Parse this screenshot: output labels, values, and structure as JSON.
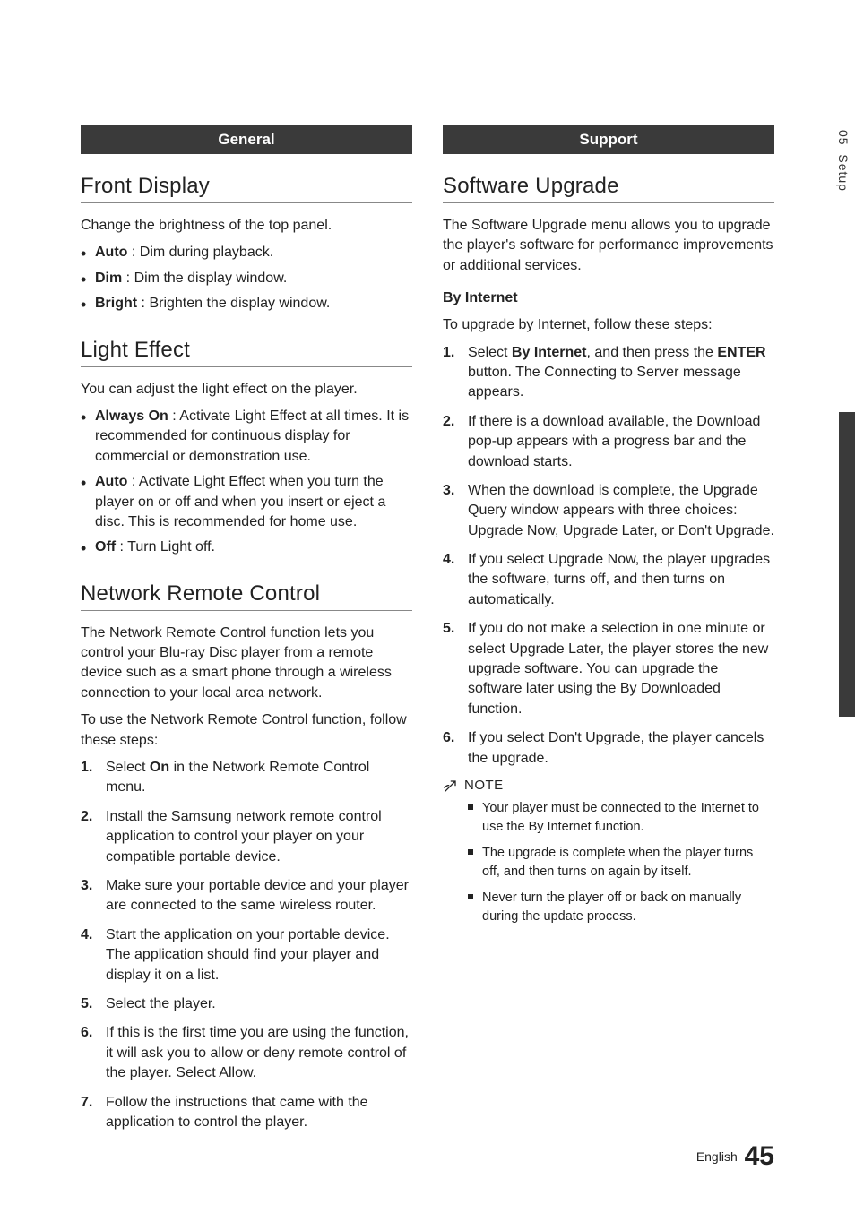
{
  "side": {
    "chapter": "05",
    "label": "Setup"
  },
  "left": {
    "banner": "General",
    "frontDisplay": {
      "title": "Front Display",
      "intro": "Change the brightness of the top panel.",
      "items": [
        {
          "label": "Auto",
          "desc": " : Dim during playback."
        },
        {
          "label": "Dim",
          "desc": " : Dim the display window."
        },
        {
          "label": "Bright",
          "desc": " : Brighten the display window."
        }
      ]
    },
    "lightEffect": {
      "title": "Light Effect",
      "intro": "You can adjust the light effect on the player.",
      "items": [
        {
          "label": "Always On",
          "desc": " : Activate Light Effect at all times. It is recommended for continuous display for commercial or demonstration use."
        },
        {
          "label": "Auto",
          "desc": " : Activate Light Effect when you turn the player on or off and when you insert or eject a disc. This is recommended for home use."
        },
        {
          "label": "Off",
          "desc": " : Turn Light off."
        }
      ]
    },
    "networkRemote": {
      "title": "Network Remote Control",
      "intro1": "The Network Remote Control function lets you control your Blu-ray Disc player from a remote device such as a smart phone through a wireless connection to your local area network.",
      "intro2": "To use the Network Remote Control function, follow these steps:",
      "steps": [
        {
          "n": "1.",
          "pre": "Select ",
          "bold": "On",
          "post": " in the Network Remote Control menu."
        },
        {
          "n": "2.",
          "text": "Install the Samsung network remote control application to control your player on your compatible portable device."
        },
        {
          "n": "3.",
          "text": "Make sure your portable device and your player are connected to the same wireless router."
        },
        {
          "n": "4.",
          "text": "Start the application on your portable device. The application should find your player and display it on a list."
        },
        {
          "n": "5.",
          "text": "Select the player."
        },
        {
          "n": "6.",
          "text": "If this is the first time you are using the function, it will ask you to allow or deny remote control of the player. Select Allow."
        },
        {
          "n": "7.",
          "text": "Follow the instructions that came with the application to control the player."
        }
      ]
    }
  },
  "right": {
    "banner": "Support",
    "softwareUpgrade": {
      "title": "Software Upgrade",
      "intro": "The Software Upgrade menu allows you to upgrade the player's software for performance improvements or additional services.",
      "byInternetTitle": "By Internet",
      "byInternetIntro": "To upgrade by Internet, follow these steps:",
      "steps": [
        {
          "n": "1.",
          "pre": "Select ",
          "bold1": "By Internet",
          "mid": ", and then press the ",
          "bold2": "ENTER",
          "post": " button. The Connecting to Server message appears."
        },
        {
          "n": "2.",
          "text": "If there is a download available, the Download pop-up appears with a progress bar and the download starts."
        },
        {
          "n": "3.",
          "text": "When the download is complete, the Upgrade Query window appears with three choices: Upgrade Now, Upgrade Later, or Don't Upgrade."
        },
        {
          "n": "4.",
          "text": "If you select Upgrade Now, the player upgrades the software, turns off, and then turns on automatically."
        },
        {
          "n": "5.",
          "text": "If you do not make a selection in one minute or select Upgrade Later, the player stores the new upgrade software. You can upgrade the software later using the By Downloaded function."
        },
        {
          "n": "6.",
          "text": "If you select Don't Upgrade, the player cancels the upgrade."
        }
      ],
      "noteLabel": "NOTE",
      "notes": [
        "Your player must be connected to the Internet to use the By Internet function.",
        "The upgrade is complete when the player turns off, and then turns on again by itself.",
        "Never turn the player off or back on manually during the update process."
      ]
    }
  },
  "footer": {
    "lang": "English",
    "page": "45"
  }
}
